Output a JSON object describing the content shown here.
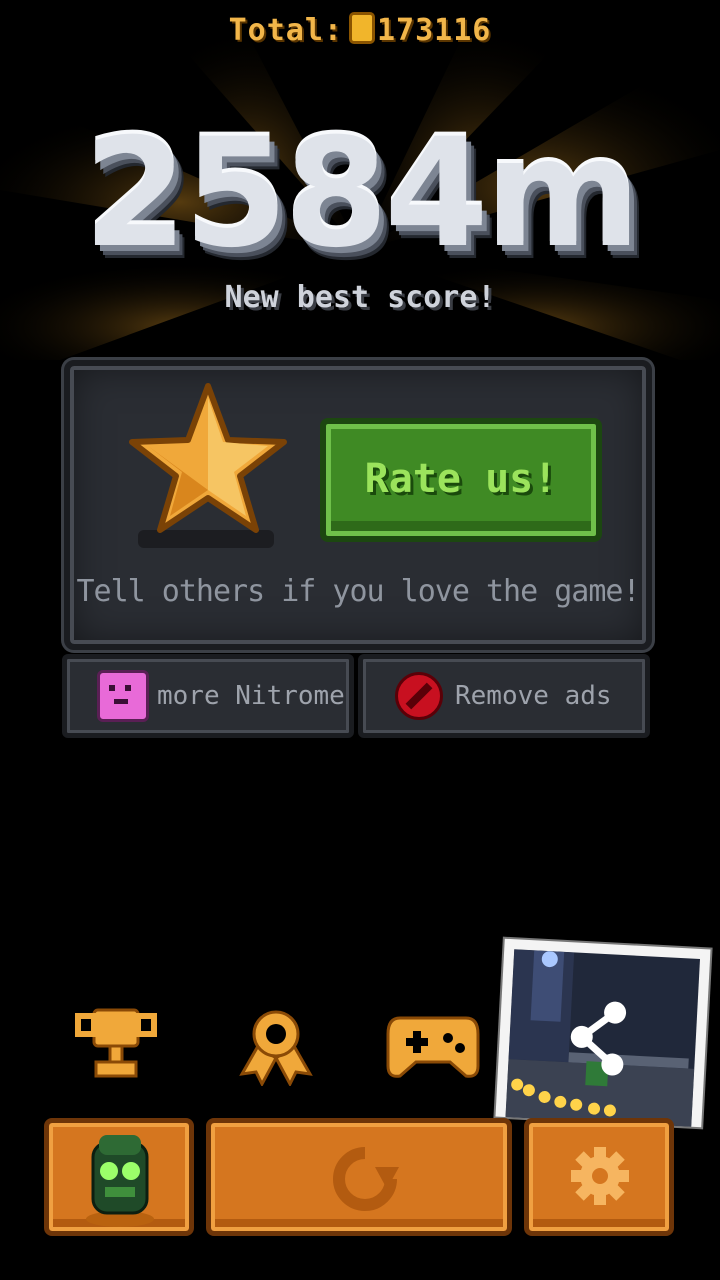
{
  "header": {
    "total_label": "Total:",
    "total_coins": "173116"
  },
  "result": {
    "distance": "2584m",
    "message": "New best score!"
  },
  "rate_panel": {
    "button_label": "Rate us!",
    "tagline": "Tell others if you love the game!"
  },
  "links": {
    "more_label": "more Nitrome",
    "remove_ads_label": "Remove ads"
  },
  "icons": {
    "leaderboard": "trophy-icon",
    "achievements": "ribbon-icon",
    "game_services": "gamepad-icon",
    "share": "share-icon",
    "character": "character-icon",
    "replay": "replay-icon",
    "settings": "gear-icon"
  },
  "colors": {
    "accent_orange": "#d5761f",
    "rate_green": "#3f8a24",
    "coin_gold": "#f1b52b"
  }
}
